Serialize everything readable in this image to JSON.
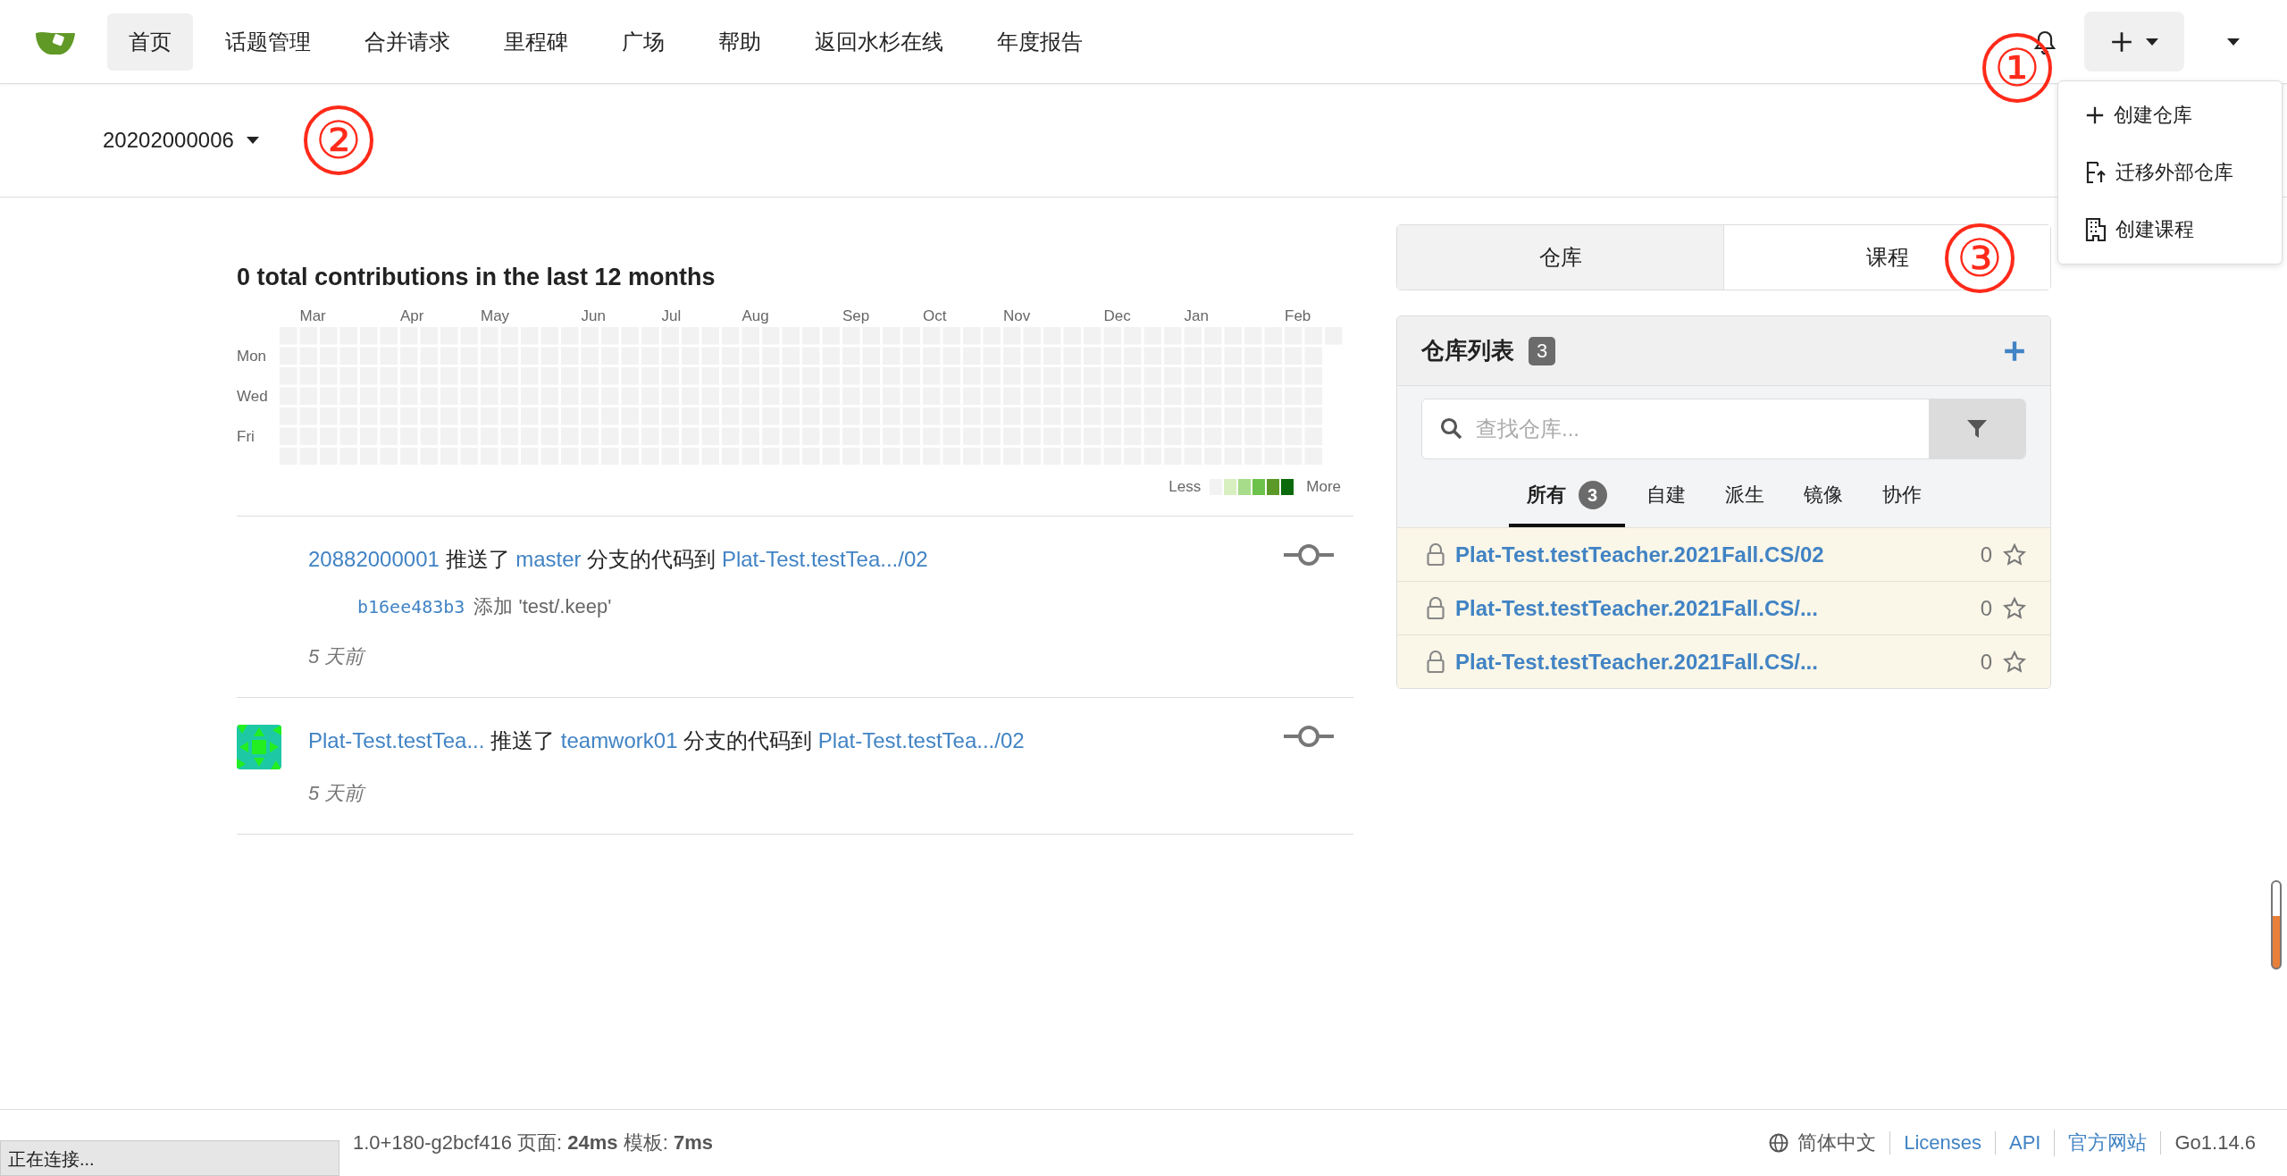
{
  "navbar": {
    "items": [
      {
        "label": "首页",
        "selected": true
      },
      {
        "label": "话题管理",
        "selected": false
      },
      {
        "label": "合并请求",
        "selected": false
      },
      {
        "label": "里程碑",
        "selected": false
      },
      {
        "label": "广场",
        "selected": false
      },
      {
        "label": "帮助",
        "selected": false
      },
      {
        "label": "返回水杉在线",
        "selected": false
      },
      {
        "label": "年度报告",
        "selected": false
      }
    ],
    "annotation": "①",
    "create_menu": {
      "open": true,
      "items": [
        {
          "kind": "plus",
          "label": "创建仓库"
        },
        {
          "kind": "migrate",
          "label": "迁移外部仓库"
        },
        {
          "kind": "building",
          "label": "创建课程"
        }
      ]
    }
  },
  "user_menu": {
    "label": "20202000006",
    "annotation": "②"
  },
  "heatmap": {
    "title": "0 total contributions in the last 12 months",
    "months": [
      "Mar",
      "Apr",
      "May",
      "Jun",
      "Jul",
      "Aug",
      "Sep",
      "Oct",
      "Nov",
      "Dec",
      "Jan",
      "Feb"
    ],
    "weekdays": [
      "Mon",
      "Wed",
      "Fri"
    ],
    "legend_less": "Less",
    "legend_more": "More"
  },
  "feed": [
    {
      "avatar": false,
      "actor": "20882000001",
      "verb": "推送了",
      "branch": "master",
      "middle": "分支的代码到",
      "repo": "Plat-Test.testTea.../02",
      "commits": [
        {
          "sha": "b16ee483b3",
          "message": "添加 'test/.keep'"
        }
      ],
      "time": "5 天前"
    },
    {
      "avatar": true,
      "actor": "Plat-Test.testTea...",
      "verb": "推送了",
      "branch": "teamwork01",
      "middle": "分支的代码到",
      "repo": "Plat-Test.testTea.../02",
      "time": "5 天前"
    }
  ],
  "side_tabs": {
    "items": [
      {
        "label": "仓库",
        "selected": true
      },
      {
        "label": "课程",
        "selected": false
      }
    ],
    "annotation": "③"
  },
  "repo_panel": {
    "title": "仓库列表",
    "count": "3",
    "search_placeholder": "查找仓库...",
    "filters": [
      {
        "label": "所有",
        "count": "3",
        "selected": true
      },
      {
        "label": "自建",
        "selected": false
      },
      {
        "label": "派生",
        "selected": false
      },
      {
        "label": "镜像",
        "selected": false
      },
      {
        "label": "协作",
        "selected": false
      }
    ],
    "repos": [
      {
        "name": "Plat-Test.testTeacher.2021Fall.CS/02",
        "private": true,
        "star_count": "0"
      },
      {
        "name": "Plat-Test.testTeacher.2021Fall.CS/...",
        "private": true,
        "star_count": "0"
      },
      {
        "name": "Plat-Test.testTeacher.2021Fall.CS/...",
        "private": true,
        "star_count": "0"
      }
    ]
  },
  "footer": {
    "version_text": "1.0+180-g2bcf416 页面: **24ms** 模板: **7ms**",
    "language": "简体中文",
    "links": [
      "Licenses",
      "API",
      "官方网站"
    ],
    "go_version": "Go1.14.6"
  },
  "status_popup": "正在连接..."
}
